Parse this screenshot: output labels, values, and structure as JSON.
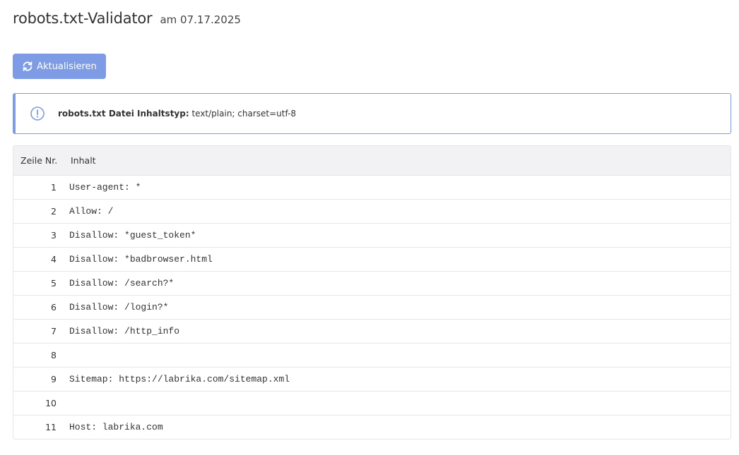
{
  "header": {
    "title": "robots.txt-Validator",
    "date": "am 07.17.2025"
  },
  "toolbar": {
    "refresh_label": "Aktualisieren",
    "refresh_icon": "refresh-icon"
  },
  "info": {
    "icon": "exclamation-circle-icon",
    "label": "robots.txt Datei Inhaltstyp:",
    "value": " text/plain; charset=utf-8"
  },
  "table": {
    "headers": [
      "Zeile Nr.",
      "Inhalt"
    ],
    "rows": [
      {
        "num": "1",
        "content": "User-agent: *"
      },
      {
        "num": "2",
        "content": "Allow: /"
      },
      {
        "num": "3",
        "content": "Disallow: *guest_token*"
      },
      {
        "num": "4",
        "content": "Disallow: *badbrowser.html"
      },
      {
        "num": "5",
        "content": "Disallow: /search?*"
      },
      {
        "num": "6",
        "content": "Disallow: /login?*"
      },
      {
        "num": "7",
        "content": "Disallow: /http_info"
      },
      {
        "num": "8",
        "content": ""
      },
      {
        "num": "9",
        "content": "Sitemap: https://labrika.com/sitemap.xml"
      },
      {
        "num": "10",
        "content": ""
      },
      {
        "num": "11",
        "content": "Host: labrika.com"
      }
    ]
  },
  "colors": {
    "accent": "#7e9ce6",
    "header_bg": "#f2f2f4",
    "border": "#e6e6e9"
  }
}
